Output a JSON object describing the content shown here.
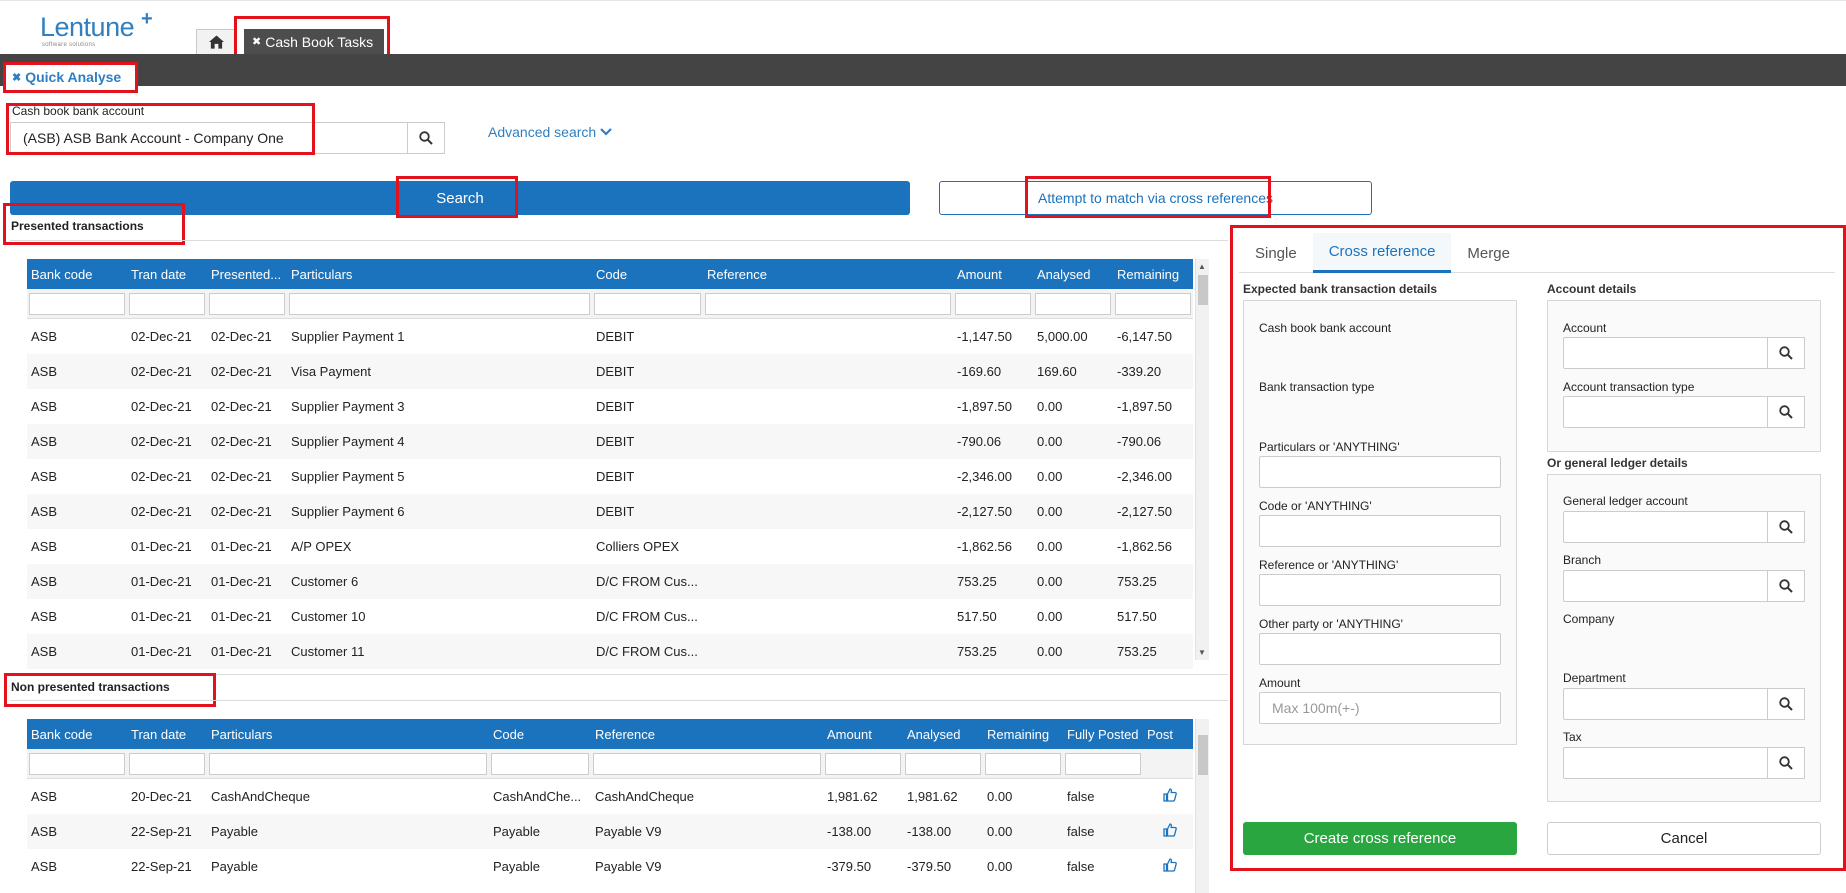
{
  "brand": {
    "name": "Lentune",
    "tagline": "software solutions"
  },
  "colors": {
    "primary": "#1b73bd",
    "dark_bar": "#444444",
    "highlight": "#e3111b",
    "success": "#2aa640"
  },
  "top_tabs": {
    "home_icon": "home-icon",
    "task_label": "Cash Book Tasks"
  },
  "quick_analyse": {
    "label": "Quick Analyse"
  },
  "cash_book_account": {
    "label": "Cash book bank account",
    "value": "(ASB) ASB Bank Account - Company One"
  },
  "advanced_search": {
    "label": "Advanced search"
  },
  "buttons": {
    "search": "Search",
    "match": "Attempt to match via cross references",
    "create": "Create cross reference",
    "cancel": "Cancel"
  },
  "presented": {
    "title": "Presented transactions",
    "headers": [
      "Bank code",
      "Tran date",
      "Presented...",
      "Particulars",
      "Code",
      "Reference",
      "Amount",
      "Analysed",
      "Remaining"
    ],
    "rows": [
      [
        "ASB",
        "02-Dec-21",
        "02-Dec-21",
        "Supplier Payment 1",
        "DEBIT",
        "",
        "-1,147.50",
        "5,000.00",
        "-6,147.50"
      ],
      [
        "ASB",
        "02-Dec-21",
        "02-Dec-21",
        "Visa Payment",
        "DEBIT",
        "",
        "-169.60",
        "169.60",
        "-339.20"
      ],
      [
        "ASB",
        "02-Dec-21",
        "02-Dec-21",
        "Supplier Payment 3",
        "DEBIT",
        "",
        "-1,897.50",
        "0.00",
        "-1,897.50"
      ],
      [
        "ASB",
        "02-Dec-21",
        "02-Dec-21",
        "Supplier Payment 4",
        "DEBIT",
        "",
        "-790.06",
        "0.00",
        "-790.06"
      ],
      [
        "ASB",
        "02-Dec-21",
        "02-Dec-21",
        "Supplier Payment 5",
        "DEBIT",
        "",
        "-2,346.00",
        "0.00",
        "-2,346.00"
      ],
      [
        "ASB",
        "02-Dec-21",
        "02-Dec-21",
        "Supplier Payment 6",
        "DEBIT",
        "",
        "-2,127.50",
        "0.00",
        "-2,127.50"
      ],
      [
        "ASB",
        "01-Dec-21",
        "01-Dec-21",
        "A/P OPEX",
        "Colliers OPEX",
        "",
        "-1,862.56",
        "0.00",
        "-1,862.56"
      ],
      [
        "ASB",
        "01-Dec-21",
        "01-Dec-21",
        "Customer 6",
        "D/C FROM Cus...",
        "",
        "753.25",
        "0.00",
        "753.25"
      ],
      [
        "ASB",
        "01-Dec-21",
        "01-Dec-21",
        "Customer 10",
        "D/C FROM Cus...",
        "",
        "517.50",
        "0.00",
        "517.50"
      ],
      [
        "ASB",
        "01-Dec-21",
        "01-Dec-21",
        "Customer 11",
        "D/C FROM Cus...",
        "",
        "753.25",
        "0.00",
        "753.25"
      ]
    ]
  },
  "non_presented": {
    "title": "Non presented transactions",
    "headers": [
      "Bank code",
      "Tran date",
      "Particulars",
      "Code",
      "Reference",
      "Amount",
      "Analysed",
      "Remaining",
      "Fully Posted",
      "Post"
    ],
    "rows": [
      [
        "ASB",
        "20-Dec-21",
        "CashAndCheque",
        "CashAndChe...",
        "CashAndCheque",
        "1,981.62",
        "1,981.62",
        "0.00",
        "false"
      ],
      [
        "ASB",
        "22-Sep-21",
        "Payable",
        "Payable",
        "Payable V9",
        "-138.00",
        "-138.00",
        "0.00",
        "false"
      ],
      [
        "ASB",
        "22-Sep-21",
        "Payable",
        "Payable",
        "Payable V9",
        "-379.50",
        "-379.50",
        "0.00",
        "false"
      ]
    ]
  },
  "right_panel": {
    "tabs": [
      "Single",
      "Cross reference",
      "Merge"
    ],
    "active_tab": "Cross reference",
    "expected": {
      "title": "Expected bank transaction details",
      "cash_book_label": "Cash book bank account",
      "tran_type_label": "Bank transaction type",
      "particulars_label": "Particulars or 'ANYTHING'",
      "code_label": "Code or 'ANYTHING'",
      "reference_label": "Reference or 'ANYTHING'",
      "other_party_label": "Other party or 'ANYTHING'",
      "amount_label": "Amount",
      "amount_placeholder": "Max 100m(+-)"
    },
    "account": {
      "title": "Account details",
      "account_label": "Account",
      "tran_type_label": "Account transaction type"
    },
    "gl": {
      "title": "Or general ledger details",
      "gl_account_label": "General ledger account",
      "branch_label": "Branch",
      "company_label": "Company",
      "department_label": "Department",
      "tax_label": "Tax"
    }
  }
}
